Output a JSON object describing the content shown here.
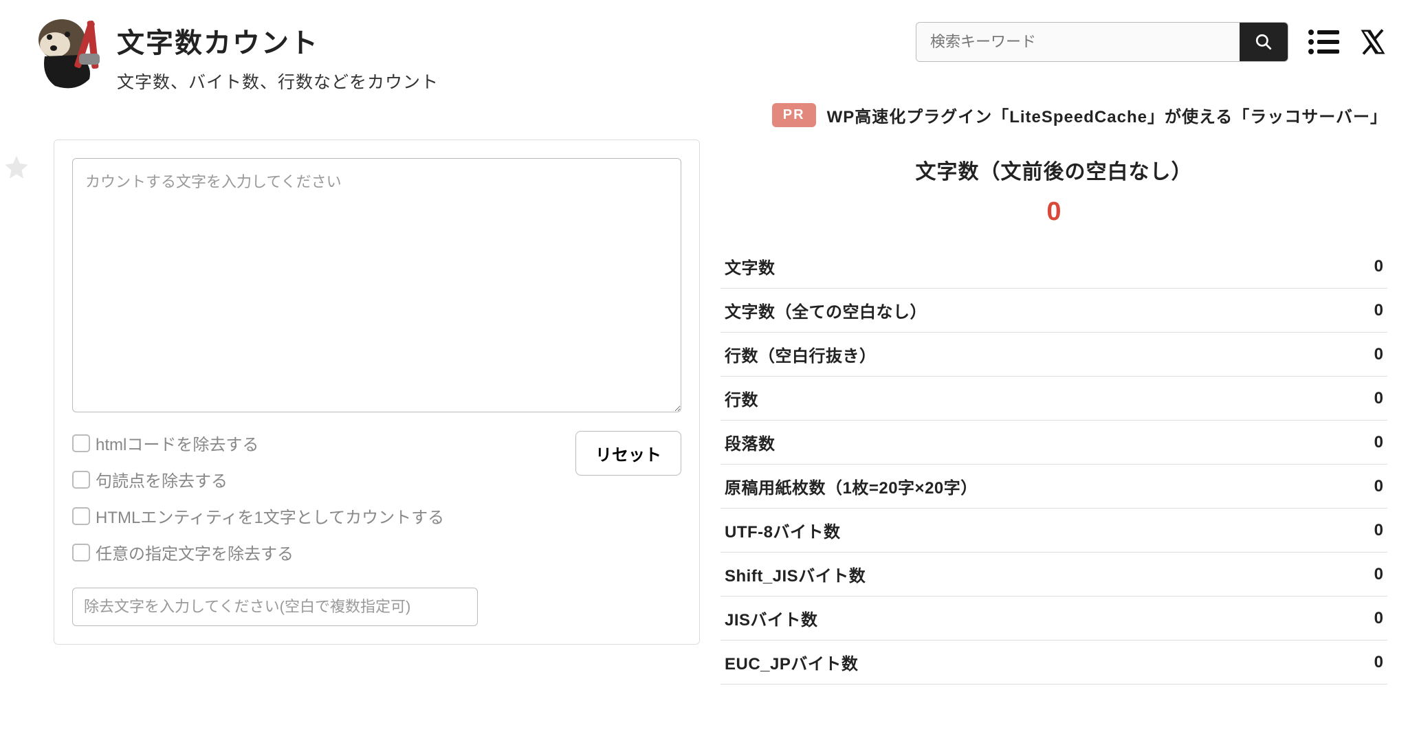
{
  "header": {
    "title": "文字数カウント",
    "subtitle": "文字数、バイト数、行数などをカウント"
  },
  "search": {
    "placeholder": "検索キーワード"
  },
  "pr": {
    "badge": "PR",
    "text": "WP高速化プラグイン「LiteSpeedCache」が使える「ラッコサーバー」"
  },
  "input": {
    "textarea_placeholder": "カウントする文字を入力してください",
    "reset_label": "リセット",
    "options": [
      "htmlコードを除去する",
      "句読点を除去する",
      "HTMLエンティティを1文字としてカウントする",
      "任意の指定文字を除去する"
    ],
    "exclude_placeholder": "除去文字を入力してください(空白で複数指定可)"
  },
  "results": {
    "main_label": "文字数（文前後の空白なし）",
    "main_value": "0",
    "rows": [
      {
        "label": "文字数",
        "value": "0"
      },
      {
        "label": "文字数（全ての空白なし）",
        "value": "0"
      },
      {
        "label": "行数（空白行抜き）",
        "value": "0"
      },
      {
        "label": "行数",
        "value": "0"
      },
      {
        "label": "段落数",
        "value": "0"
      },
      {
        "label": "原稿用紙枚数（1枚=20字×20字）",
        "value": "0"
      },
      {
        "label": "UTF-8バイト数",
        "value": "0"
      },
      {
        "label": "Shift_JISバイト数",
        "value": "0"
      },
      {
        "label": "JISバイト数",
        "value": "0"
      },
      {
        "label": "EUC_JPバイト数",
        "value": "0"
      }
    ]
  }
}
